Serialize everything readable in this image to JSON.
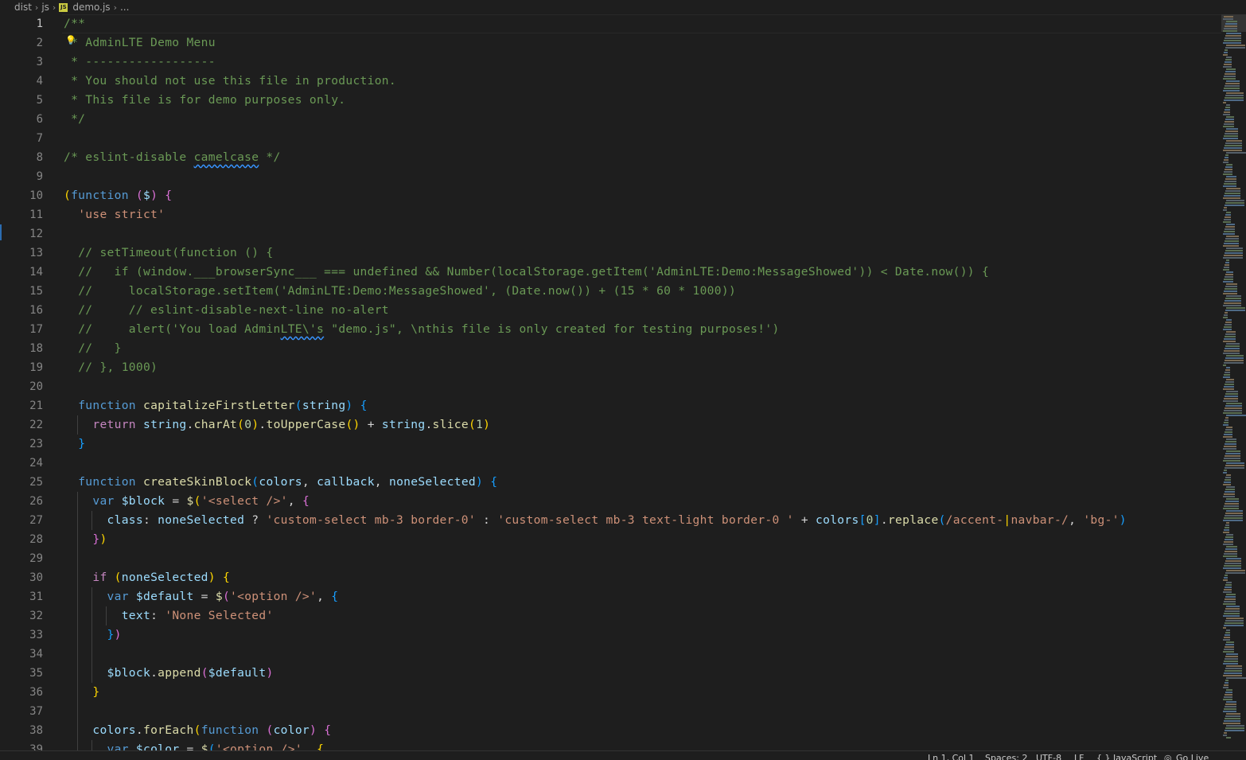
{
  "breadcrumb": {
    "items": [
      "dist",
      "js",
      "demo.js",
      "..."
    ],
    "file_icon": "javascript-file-icon"
  },
  "editor": {
    "active_line": 1,
    "lines": [
      {
        "n": "1",
        "html": "<span class=\"c\">/**</span>"
      },
      {
        "n": "2",
        "html": "<span class=\"c\"> * AdminLTE Demo Menu</span>"
      },
      {
        "n": "3",
        "html": "<span class=\"c\"> * ------------------</span>"
      },
      {
        "n": "4",
        "html": "<span class=\"c\"> * You should not use this file in production.</span>"
      },
      {
        "n": "5",
        "html": "<span class=\"c\"> * This file is for demo purposes only.</span>"
      },
      {
        "n": "6",
        "html": "<span class=\"c\"> */</span>"
      },
      {
        "n": "7",
        "html": ""
      },
      {
        "n": "8",
        "html": "<span class=\"c\">/* eslint-disable <span class=\"wavy\">camelcase</span> */</span>"
      },
      {
        "n": "9",
        "html": ""
      },
      {
        "n": "10",
        "html": "<span class=\"p1\">(</span><span class=\"k\">function</span> <span class=\"p2\">(</span><span class=\"v\">$</span><span class=\"p2\">)</span> <span class=\"p2\">{</span>"
      },
      {
        "n": "11",
        "html": "  <span class=\"s\">'use strict'</span>"
      },
      {
        "n": "12",
        "html": ""
      },
      {
        "n": "13",
        "html": "  <span class=\"c\">// setTimeout(function () {</span>"
      },
      {
        "n": "14",
        "html": "  <span class=\"c\">//   if (window.___browserSync___ === undefined &amp;&amp; Number(localStorage.getItem('AdminLTE:Demo:MessageShowed')) &lt; Date.now()) {</span>"
      },
      {
        "n": "15",
        "html": "  <span class=\"c\">//     localStorage.setItem('AdminLTE:Demo:MessageShowed', (Date.now()) + (15 * 60 * 1000))</span>"
      },
      {
        "n": "16",
        "html": "  <span class=\"c\">//     // eslint-disable-next-line no-alert</span>"
      },
      {
        "n": "17",
        "html": "  <span class=\"c\">//     alert('You load Admin<span class=\"wavy\">LTE\\'s</span> \"demo.js\", \\nthis file is only created for testing purposes!')</span>"
      },
      {
        "n": "18",
        "html": "  <span class=\"c\">//   }</span>"
      },
      {
        "n": "19",
        "html": "  <span class=\"c\">// }, 1000)</span>"
      },
      {
        "n": "20",
        "html": ""
      },
      {
        "n": "21",
        "html": "  <span class=\"k\">function</span> <span class=\"f\">capitalizeFirstLetter</span><span class=\"p3\">(</span><span class=\"v\">string</span><span class=\"p3\">)</span> <span class=\"p3\">{</span>"
      },
      {
        "n": "22",
        "html": "    <span class=\"kf\">return</span> <span class=\"v\">string</span>.<span class=\"f\">charAt</span><span class=\"p1\">(</span><span class=\"n\">0</span><span class=\"p1\">)</span>.<span class=\"f\">toUpperCase</span><span class=\"p1\">()</span> + <span class=\"v\">string</span>.<span class=\"f\">slice</span><span class=\"p1\">(</span><span class=\"n\">1</span><span class=\"p1\">)</span>"
      },
      {
        "n": "23",
        "html": "  <span class=\"p3\">}</span>"
      },
      {
        "n": "24",
        "html": ""
      },
      {
        "n": "25",
        "html": "  <span class=\"k\">function</span> <span class=\"f\">createSkinBlock</span><span class=\"p3\">(</span><span class=\"v\">colors</span>, <span class=\"v\">callback</span>, <span class=\"v\">noneSelected</span><span class=\"p3\">)</span> <span class=\"p3\">{</span>"
      },
      {
        "n": "26",
        "html": "    <span class=\"k\">var</span> <span class=\"v\">$block</span> = <span class=\"f\">$</span><span class=\"p1\">(</span><span class=\"s\">'&lt;select /&gt;'</span>, <span class=\"p2\">{</span>"
      },
      {
        "n": "27",
        "html": "      <span class=\"v\">class</span>: <span class=\"v\">noneSelected</span> ? <span class=\"s\">'custom-select mb-3 border-0'</span> : <span class=\"s\">'custom-select mb-3 text-light border-0 '</span> + <span class=\"v\">colors</span><span class=\"p3\">[</span><span class=\"n\">0</span><span class=\"p3\">]</span>.<span class=\"f\">replace</span><span class=\"p3\">(</span><span class=\"s\">/accent-</span><span class=\"p1\">|</span><span class=\"s\">navbar-/</span>, <span class=\"s\">'bg-'</span><span class=\"p3\">)</span>"
      },
      {
        "n": "28",
        "html": "    <span class=\"p2\">}</span><span class=\"p1\">)</span>"
      },
      {
        "n": "29",
        "html": ""
      },
      {
        "n": "30",
        "html": "    <span class=\"kf\">if</span> <span class=\"p1\">(</span><span class=\"v\">noneSelected</span><span class=\"p1\">)</span> <span class=\"p1\">{</span>"
      },
      {
        "n": "31",
        "html": "      <span class=\"k\">var</span> <span class=\"v\">$default</span> = <span class=\"f\">$</span><span class=\"p2\">(</span><span class=\"s\">'&lt;option /&gt;'</span>, <span class=\"p3\">{</span>"
      },
      {
        "n": "32",
        "html": "        <span class=\"v\">text</span>: <span class=\"s\">'None Selected'</span>"
      },
      {
        "n": "33",
        "html": "      <span class=\"p3\">}</span><span class=\"p2\">)</span>"
      },
      {
        "n": "34",
        "html": ""
      },
      {
        "n": "35",
        "html": "      <span class=\"v\">$block</span>.<span class=\"f\">append</span><span class=\"p2\">(</span><span class=\"v\">$default</span><span class=\"p2\">)</span>"
      },
      {
        "n": "36",
        "html": "    <span class=\"p1\">}</span>"
      },
      {
        "n": "37",
        "html": ""
      },
      {
        "n": "38",
        "html": "    <span class=\"v\">colors</span>.<span class=\"f\">forEach</span><span class=\"p1\">(</span><span class=\"k\">function</span> <span class=\"p2\">(</span><span class=\"v\">color</span><span class=\"p2\">)</span> <span class=\"p2\">{</span>"
      },
      {
        "n": "39",
        "html": "      <span class=\"k\">var</span> <span class=\"v\">$color</span> = <span class=\"f\">$</span><span class=\"p3\">(</span><span class=\"s\">'&lt;option /&gt;'</span>, <span class=\"p1\">{</span>"
      }
    ]
  },
  "statusbar": {
    "position": "Ln 1, Col 1",
    "spaces": "Spaces: 2",
    "encoding": "UTF-8",
    "eol": "LF",
    "language": "{ } JavaScript",
    "golive": "Go Live"
  },
  "colors": {
    "background": "#1e1e1e",
    "comment": "#6a9955",
    "keyword": "#569cd6",
    "string": "#ce9178",
    "function": "#dcdcaa",
    "variable": "#9cdcfe"
  }
}
